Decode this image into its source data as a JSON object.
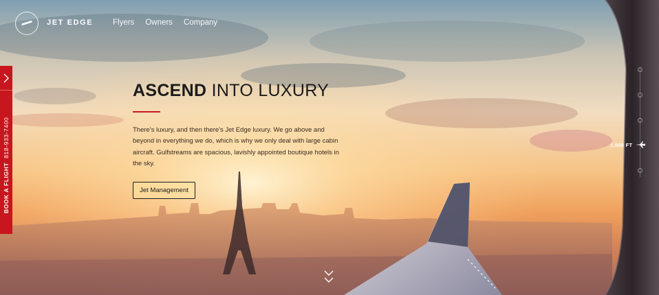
{
  "header": {
    "brand": "JET EDGE",
    "nav": [
      "Flyers",
      "Owners",
      "Company"
    ]
  },
  "side_tab": {
    "label": "BOOK A FLIGHT",
    "phone": "818-933-7400",
    "accent": "#c8161e"
  },
  "hero": {
    "headline_strong": "ASCEND",
    "headline_light": "INTO LUXURY",
    "body": "There's luxury, and then there's Jet Edge luxury. We go above and beyond in everything we do, which is why we only deal with large cabin aircraft. Gulfstreams are spacious, lavishly appointed boutique hotels in the sky.",
    "cta_label": "Jet Management"
  },
  "altitude": {
    "label": "1,000 FT"
  },
  "icons": [
    "logo-icon",
    "chevron-right-icon",
    "airplane-icon",
    "double-chevron-down-icon"
  ]
}
